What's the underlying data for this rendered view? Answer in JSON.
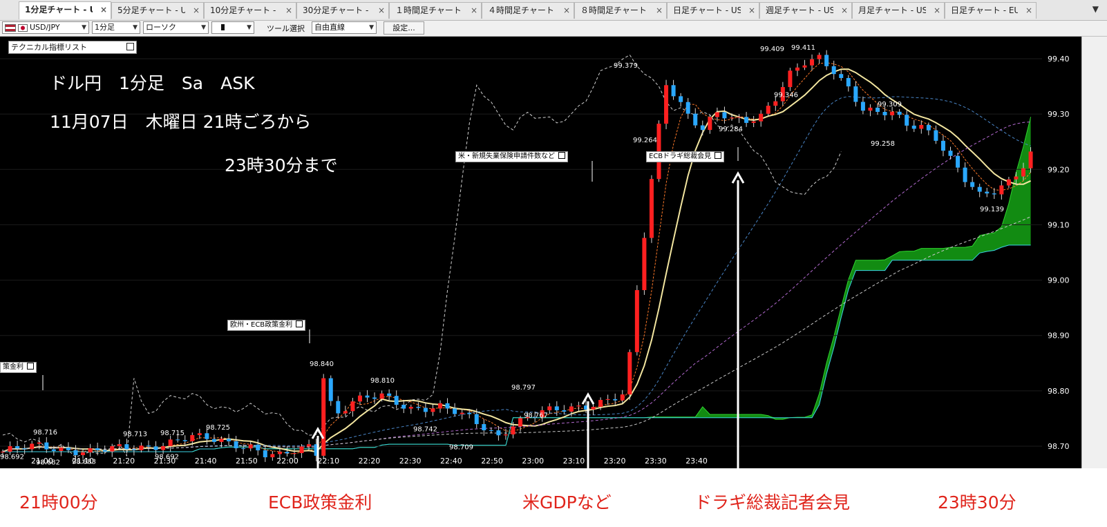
{
  "tabs": [
    {
      "label": "1分足チャート - U",
      "active": true
    },
    {
      "label": "5分足チャート - US"
    },
    {
      "label": "10分足チャート - US"
    },
    {
      "label": "30分足チャート - US"
    },
    {
      "label": "１時間足チャート - U"
    },
    {
      "label": "４時間足チャート - U"
    },
    {
      "label": "８時間足チャート - U"
    },
    {
      "label": "日足チャート - USD"
    },
    {
      "label": "週足チャート - USD"
    },
    {
      "label": "月足チャート - USD"
    },
    {
      "label": "日足チャート - EUR/"
    }
  ],
  "tab_close": "×",
  "tab_menu": "▼",
  "toolbar": {
    "pair": "USD/JPY",
    "timeframe": "1分足",
    "chart_style": "ローソク",
    "tool_label": "ツール選択",
    "tool_value": "自由直線",
    "settings": "設定..."
  },
  "indicator_list": "テクニカル指標リスト",
  "annotations": {
    "line1": "ドル円　1分足　Sa　ASK",
    "line2": "11月07日　木曜日 21時ごろから",
    "line3": "23時30分まで"
  },
  "events": [
    {
      "label": "策金利"
    },
    {
      "label": "欧州・ECB政策金利"
    },
    {
      "label": "米・新規失業保険申請件数など"
    },
    {
      "label": "ECBドラギ総裁会見"
    }
  ],
  "bottom_labels": {
    "t1": "21時00分",
    "t2": "ECB政策金利",
    "t3": "米GDPなど",
    "t4": "ドラギ総裁記者会見",
    "t5": "23時30分"
  },
  "price_labels": [
    "98.692",
    "98.716",
    "98.682",
    "98.683",
    "98.713",
    "98.715",
    "98.692",
    "98.725",
    "98.663",
    "98.840",
    "98.810",
    "98.742",
    "98.709",
    "98.797",
    "98.767",
    "99.379",
    "99.264",
    "99.409",
    "99.411",
    "99.346",
    "99.284",
    "99.309",
    "99.258",
    "99.139"
  ],
  "chart_data": {
    "type": "candlestick",
    "symbol": "USD/JPY",
    "y_ticks": [
      "99.40",
      "99.30",
      "99.20",
      "99.10",
      "99.00",
      "98.90",
      "98.80",
      "98.70"
    ],
    "x_ticks": [
      "21:00",
      "21:10",
      "21:20",
      "21:30",
      "21:40",
      "21:50",
      "22:00",
      "22:10",
      "22:20",
      "22:30",
      "22:40",
      "22:50",
      "23:00",
      "23:10",
      "23:20",
      "23:30",
      "23:40"
    ],
    "ylim": [
      98.66,
      99.44
    ],
    "price_path": [
      [
        0,
        98.69
      ],
      [
        5,
        98.7
      ],
      [
        12,
        98.69
      ],
      [
        20,
        98.7
      ],
      [
        26,
        98.715
      ],
      [
        30,
        98.71
      ],
      [
        34,
        98.7
      ],
      [
        36,
        98.685
      ],
      [
        38,
        98.68
      ],
      [
        40,
        98.69
      ],
      [
        42,
        98.7
      ],
      [
        43,
        98.69
      ],
      [
        44,
        98.83
      ],
      [
        45,
        98.78
      ],
      [
        46,
        98.76
      ],
      [
        48,
        98.78
      ],
      [
        52,
        98.79
      ],
      [
        56,
        98.77
      ],
      [
        60,
        98.77
      ],
      [
        64,
        98.75
      ],
      [
        68,
        98.72
      ],
      [
        70,
        98.74
      ],
      [
        74,
        98.76
      ],
      [
        78,
        98.77
      ],
      [
        82,
        98.78
      ],
      [
        85,
        98.79
      ],
      [
        86,
        98.86
      ],
      [
        87,
        98.98
      ],
      [
        88,
        99.08
      ],
      [
        89,
        99.18
      ],
      [
        90,
        99.28
      ],
      [
        91,
        99.36
      ],
      [
        92,
        99.34
      ],
      [
        94,
        99.3
      ],
      [
        96,
        99.27
      ],
      [
        98,
        99.3
      ],
      [
        100,
        99.29
      ],
      [
        102,
        99.29
      ],
      [
        104,
        99.3
      ],
      [
        106,
        99.33
      ],
      [
        108,
        99.37
      ],
      [
        110,
        99.39
      ],
      [
        112,
        99.4
      ],
      [
        114,
        99.38
      ],
      [
        116,
        99.35
      ],
      [
        118,
        99.31
      ],
      [
        120,
        99.3
      ],
      [
        122,
        99.3
      ],
      [
        124,
        99.28
      ],
      [
        126,
        99.28
      ],
      [
        128,
        99.26
      ],
      [
        130,
        99.22
      ],
      [
        132,
        99.18
      ],
      [
        134,
        99.15
      ],
      [
        136,
        99.16
      ],
      [
        138,
        99.18
      ],
      [
        140,
        99.21
      ],
      [
        141,
        99.23
      ]
    ]
  }
}
